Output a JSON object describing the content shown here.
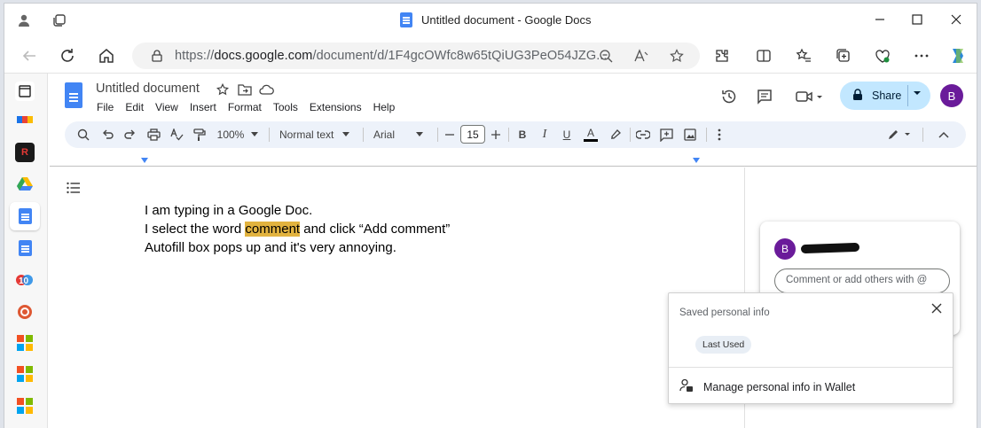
{
  "browser": {
    "window_title": "Untitled document - Google Docs",
    "url_prefix": "https://",
    "url_domain": "docs.google.com",
    "url_path": "/document/d/1F4gcOWfc8w65tQiUG3PeO54JZG..."
  },
  "docs": {
    "title": "Untitled document",
    "menu": [
      "File",
      "Edit",
      "View",
      "Insert",
      "Format",
      "Tools",
      "Extensions",
      "Help"
    ],
    "share_label": "Share",
    "avatar_initial": "B"
  },
  "toolbar": {
    "zoom": "100%",
    "style": "Normal text",
    "font": "Arial",
    "font_size": "15",
    "bold": "B",
    "italic": "I",
    "underline": "U",
    "text_color_letter": "A"
  },
  "document": {
    "line1": "I am typing in a Google Doc.",
    "line2_before": "I select the word ",
    "line2_highlight": "comment",
    "line2_after": " and click “Add comment”",
    "line3": "Autofill box pops up and it's very annoying."
  },
  "comment": {
    "avatar_initial": "B",
    "placeholder": "Comment or add others with @"
  },
  "autofill": {
    "heading": "Saved personal info",
    "chip": "Last Used",
    "wallet_link": "Manage personal info in Wallet"
  },
  "colors": {
    "highlight": "#e2b33f",
    "share_bg": "#c2e7ff",
    "avatar": "#6a1b9a",
    "docs_blue": "#4285f4"
  }
}
